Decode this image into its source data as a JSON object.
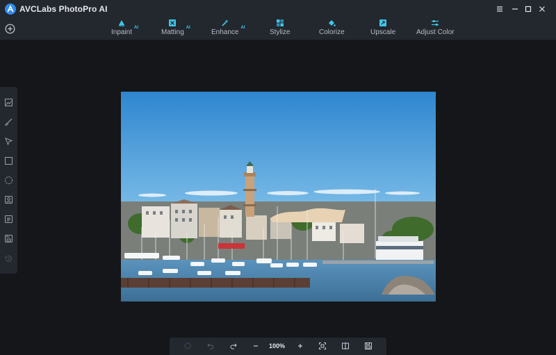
{
  "app": {
    "title": "AVCLabs PhotoPro AI"
  },
  "window_controls": [
    "menu-icon",
    "minimize-icon",
    "maximize-icon",
    "close-icon"
  ],
  "toolbar": {
    "tools": [
      {
        "label": "Inpaint",
        "ai": "AI",
        "icon": "inpaint-icon"
      },
      {
        "label": "Matting",
        "ai": "AI",
        "icon": "matting-icon"
      },
      {
        "label": "Enhance",
        "ai": "AI",
        "icon": "enhance-icon"
      },
      {
        "label": "Stylize",
        "ai": "",
        "icon": "stylize-icon"
      },
      {
        "label": "Colorize",
        "ai": "",
        "icon": "colorize-icon"
      },
      {
        "label": "Upscale",
        "ai": "",
        "icon": "upscale-icon"
      },
      {
        "label": "Adjust Color",
        "ai": "",
        "icon": "adjust-color-icon"
      }
    ]
  },
  "sidebar": {
    "tools": [
      "image-icon",
      "brush-icon",
      "pointer-icon",
      "rectangle-select-icon",
      "lasso-select-icon",
      "portrait-icon",
      "text-select-icon",
      "save-layer-icon",
      "history-icon"
    ]
  },
  "bottombar": {
    "zoom": "100%",
    "buttons": [
      "reset-icon",
      "undo-icon",
      "redo-icon",
      "zoom-out-icon",
      "zoom-in-icon",
      "fit-screen-icon",
      "compare-icon",
      "save-icon"
    ]
  },
  "colors": {
    "background": "#141619",
    "panel": "#23272e",
    "accent": "#3fc7e8",
    "icon": "#9aa1ab"
  }
}
